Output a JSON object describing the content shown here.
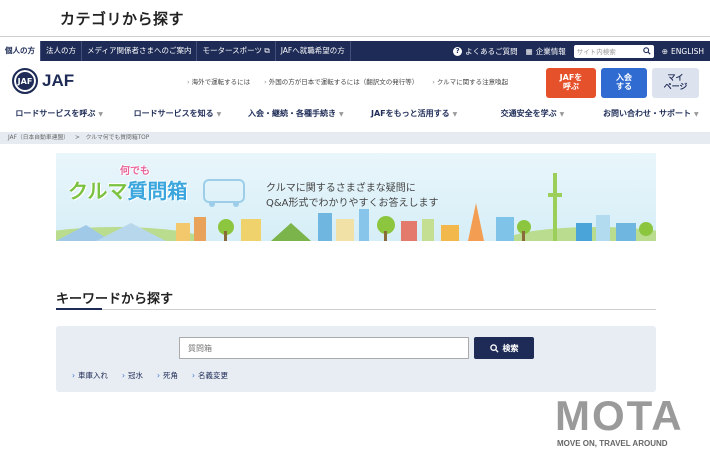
{
  "category_heading": "カテゴリから探す",
  "topbar": {
    "items": [
      "個人の方",
      "法人の方",
      "メディア関係者さまへのご案内",
      "モータースポーツ",
      "JAFへ就職希望の方"
    ],
    "faq": "よくあるご質問",
    "company": "企業情報",
    "search_placeholder": "サイト内検索",
    "english": "ENGLISH"
  },
  "header": {
    "logo_mark": "JAF",
    "logo_text": "JAF",
    "quick_links": [
      "海外で運転するには",
      "外国の方が日本で運転するには（翻訳文の発行等）",
      "クルマに関する注意喚起"
    ],
    "btn_call": "JAFを\n呼ぶ",
    "btn_join": "入会\nする",
    "btn_mypage": "マイ\nページ"
  },
  "nav": {
    "items": [
      "ロードサービスを呼ぶ",
      "ロードサービスを知る",
      "入会・継続・各種手続き",
      "JAFをもっと活用する",
      "交通安全を学ぶ",
      "お問い合わせ・サポート"
    ]
  },
  "breadcrumb": {
    "home": "JAF（日本自動車連盟）",
    "sep": ">",
    "current": "クルマ何でも質問箱TOP"
  },
  "hero": {
    "title_kuruma": "クルマ",
    "title_nandemo": "何でも",
    "title_box": "質問箱",
    "text1": "クルマに関するさまざまな疑問に",
    "text2": "Q&A形式でわかりやすくお答えします"
  },
  "keyword": {
    "heading": "キーワードから探す",
    "input_placeholder": "質問箱",
    "search_button": "検索",
    "tags": [
      "車庫入れ",
      "冠水",
      "死角",
      "名義変更"
    ]
  },
  "watermark": {
    "logo": "MOTA",
    "tagline": "MOVE ON, TRAVEL AROUND"
  },
  "colors": {
    "navy": "#1d2b56",
    "red": "#e5512a",
    "blue": "#2f6bd1"
  }
}
